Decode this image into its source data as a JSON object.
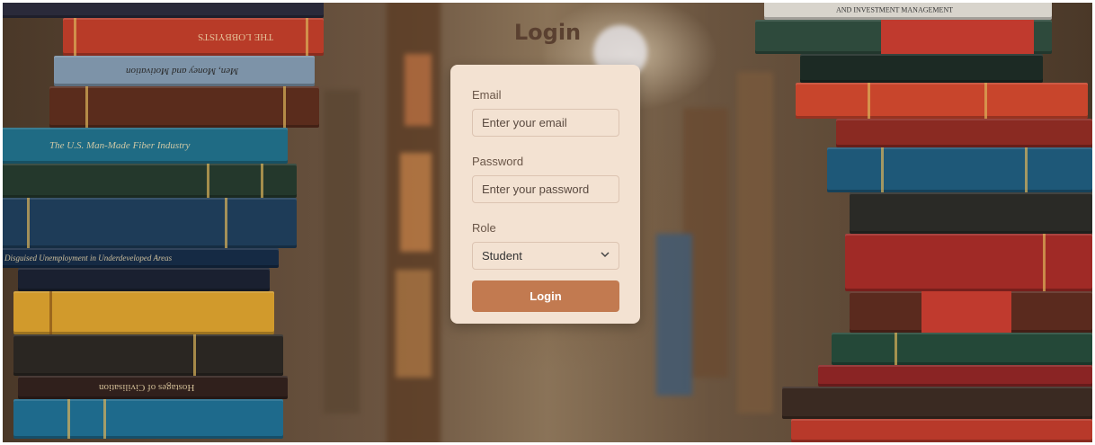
{
  "page": {
    "title": "Login"
  },
  "form": {
    "email_label": "Email",
    "email_placeholder": "Enter your email",
    "password_label": "Password",
    "password_placeholder": "Enter your password",
    "role_label": "Role",
    "role_selected": "Student",
    "submit_label": "Login"
  },
  "background": {
    "book_titles_left": [
      "THE LOBBYISTS",
      "Men, Money and Motivation",
      "The U.S. Man-Made Fiber Industry",
      "Disguised Unemployment in Underdeveloped Areas",
      "Hostages of Civilisation"
    ],
    "book_titles_right": [
      "AND INVESTMENT MANAGEMENT"
    ]
  },
  "colors": {
    "accent": "#c27a50",
    "card": "#f3e2d2",
    "title": "#5a4030"
  }
}
